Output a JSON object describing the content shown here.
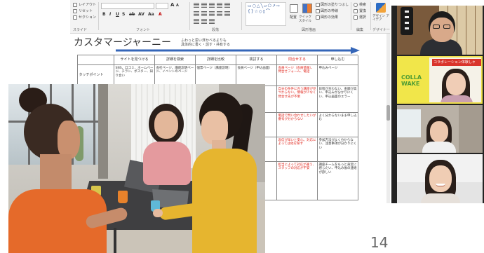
{
  "ribbon": {
    "slide_buttons": [
      "レイアウト",
      "リセット",
      "セクション"
    ],
    "font_glyphs": [
      "A",
      "A",
      "B",
      "I",
      "U",
      "S",
      "ab",
      "AV",
      "Aa",
      "A"
    ],
    "shapes_glyphs": "▭○△╲▱⬠↗⇨{}☆◇▯⌒",
    "arrange": "配置",
    "quick_styles": "クイック スタイル",
    "shape_fill": "図形の塗りつぶし",
    "shape_outline": "図形の枠線",
    "shape_effect": "図形の効果",
    "find": "検索",
    "replace": "置換",
    "select": "選択",
    "design_ideas": "デザイン アイデア",
    "group_labels": [
      "スライド",
      "フォント",
      "段落",
      "図形描画",
      "編集",
      "デザイナー"
    ]
  },
  "slide": {
    "title": "カスタマージャーニー",
    "note": [
      "ふわっと思い浮かべるよりも",
      "具体的に書く・話す・共有する"
    ],
    "table": {
      "headers": [
        "サイトを見つける",
        "詳細を検索",
        "詳細を比較",
        "検討する",
        "問合せする",
        "申し込む"
      ],
      "rows": [
        {
          "label": "タッチポイント",
          "c1": "SNS、口コミ、ホームページ、チラシ、ポスター、知り合い",
          "c2": "会社ページ、講座説明ページ、イベントのページ",
          "c3": "個票ページ（講座説明）",
          "c4": "会員ページ（申込画面）",
          "c5": "会員ページ（会員情報）、問合せフォーム、電話",
          "c6": "申込みページ"
        },
        {
          "c5": "自分の条件に合う講座が見つからない。情報が少なく問合せ先が不明",
          "c6": "日程が合わない、金額が高い、申込みが分かりにくい、申込画面のエラー"
        },
        {
          "c5": "電話で問い合わせしたいが番号が分からない",
          "c6": "よく分からないまま申し込む"
        },
        {
          "c5": "返信が早いと安心。対応によっては他を探す",
          "c6": "参加方法がよく分からない、注意事項が分かりにくい"
        },
        {
          "c5": "担当によって対応が違う、スタッフの対応が不安",
          "c6": "講座チームをもっと身近に感じたい、申込み後の連絡が欲しい"
        }
      ]
    }
  },
  "zoom": {
    "tile2": {
      "banner": "コラボレーション体験しゃ",
      "logo_line1": "COLLA",
      "logo_line2": "WAKE"
    }
  },
  "page_number": "14",
  "colors": {
    "accent_blue": "#3566b8",
    "warning_red": "#e0261c",
    "active_speaker": "#efe04a",
    "zoom_bg": "#232323",
    "ribbon_bg": "#f3f3f3"
  },
  "icons": {
    "layout": "layout-icon",
    "reset": "reset-icon",
    "section": "section-icon",
    "arrange": "arrange-icon",
    "quick_styles": "quick-styles-icon",
    "shape_fill": "paint-bucket-icon",
    "shape_outline": "pen-outline-icon",
    "shape_effect": "effects-icon",
    "find": "search-icon",
    "replace": "replace-icon",
    "select": "cursor-icon",
    "design_ideas": "design-ideas-icon"
  }
}
